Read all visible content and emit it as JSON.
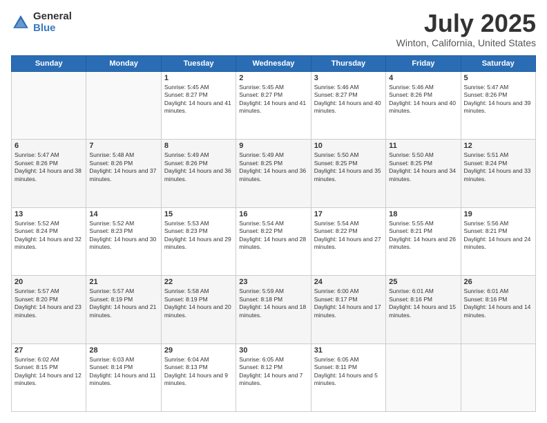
{
  "header": {
    "logo_general": "General",
    "logo_blue": "Blue",
    "month_title": "July 2025",
    "location": "Winton, California, United States"
  },
  "days_of_week": [
    "Sunday",
    "Monday",
    "Tuesday",
    "Wednesday",
    "Thursday",
    "Friday",
    "Saturday"
  ],
  "weeks": [
    [
      {
        "day": "",
        "sunrise": "",
        "sunset": "",
        "daylight": ""
      },
      {
        "day": "",
        "sunrise": "",
        "sunset": "",
        "daylight": ""
      },
      {
        "day": "1",
        "sunrise": "Sunrise: 5:45 AM",
        "sunset": "Sunset: 8:27 PM",
        "daylight": "Daylight: 14 hours and 41 minutes."
      },
      {
        "day": "2",
        "sunrise": "Sunrise: 5:45 AM",
        "sunset": "Sunset: 8:27 PM",
        "daylight": "Daylight: 14 hours and 41 minutes."
      },
      {
        "day": "3",
        "sunrise": "Sunrise: 5:46 AM",
        "sunset": "Sunset: 8:27 PM",
        "daylight": "Daylight: 14 hours and 40 minutes."
      },
      {
        "day": "4",
        "sunrise": "Sunrise: 5:46 AM",
        "sunset": "Sunset: 8:26 PM",
        "daylight": "Daylight: 14 hours and 40 minutes."
      },
      {
        "day": "5",
        "sunrise": "Sunrise: 5:47 AM",
        "sunset": "Sunset: 8:26 PM",
        "daylight": "Daylight: 14 hours and 39 minutes."
      }
    ],
    [
      {
        "day": "6",
        "sunrise": "Sunrise: 5:47 AM",
        "sunset": "Sunset: 8:26 PM",
        "daylight": "Daylight: 14 hours and 38 minutes."
      },
      {
        "day": "7",
        "sunrise": "Sunrise: 5:48 AM",
        "sunset": "Sunset: 8:26 PM",
        "daylight": "Daylight: 14 hours and 37 minutes."
      },
      {
        "day": "8",
        "sunrise": "Sunrise: 5:49 AM",
        "sunset": "Sunset: 8:26 PM",
        "daylight": "Daylight: 14 hours and 36 minutes."
      },
      {
        "day": "9",
        "sunrise": "Sunrise: 5:49 AM",
        "sunset": "Sunset: 8:25 PM",
        "daylight": "Daylight: 14 hours and 36 minutes."
      },
      {
        "day": "10",
        "sunrise": "Sunrise: 5:50 AM",
        "sunset": "Sunset: 8:25 PM",
        "daylight": "Daylight: 14 hours and 35 minutes."
      },
      {
        "day": "11",
        "sunrise": "Sunrise: 5:50 AM",
        "sunset": "Sunset: 8:25 PM",
        "daylight": "Daylight: 14 hours and 34 minutes."
      },
      {
        "day": "12",
        "sunrise": "Sunrise: 5:51 AM",
        "sunset": "Sunset: 8:24 PM",
        "daylight": "Daylight: 14 hours and 33 minutes."
      }
    ],
    [
      {
        "day": "13",
        "sunrise": "Sunrise: 5:52 AM",
        "sunset": "Sunset: 8:24 PM",
        "daylight": "Daylight: 14 hours and 32 minutes."
      },
      {
        "day": "14",
        "sunrise": "Sunrise: 5:52 AM",
        "sunset": "Sunset: 8:23 PM",
        "daylight": "Daylight: 14 hours and 30 minutes."
      },
      {
        "day": "15",
        "sunrise": "Sunrise: 5:53 AM",
        "sunset": "Sunset: 8:23 PM",
        "daylight": "Daylight: 14 hours and 29 minutes."
      },
      {
        "day": "16",
        "sunrise": "Sunrise: 5:54 AM",
        "sunset": "Sunset: 8:22 PM",
        "daylight": "Daylight: 14 hours and 28 minutes."
      },
      {
        "day": "17",
        "sunrise": "Sunrise: 5:54 AM",
        "sunset": "Sunset: 8:22 PM",
        "daylight": "Daylight: 14 hours and 27 minutes."
      },
      {
        "day": "18",
        "sunrise": "Sunrise: 5:55 AM",
        "sunset": "Sunset: 8:21 PM",
        "daylight": "Daylight: 14 hours and 26 minutes."
      },
      {
        "day": "19",
        "sunrise": "Sunrise: 5:56 AM",
        "sunset": "Sunset: 8:21 PM",
        "daylight": "Daylight: 14 hours and 24 minutes."
      }
    ],
    [
      {
        "day": "20",
        "sunrise": "Sunrise: 5:57 AM",
        "sunset": "Sunset: 8:20 PM",
        "daylight": "Daylight: 14 hours and 23 minutes."
      },
      {
        "day": "21",
        "sunrise": "Sunrise: 5:57 AM",
        "sunset": "Sunset: 8:19 PM",
        "daylight": "Daylight: 14 hours and 21 minutes."
      },
      {
        "day": "22",
        "sunrise": "Sunrise: 5:58 AM",
        "sunset": "Sunset: 8:19 PM",
        "daylight": "Daylight: 14 hours and 20 minutes."
      },
      {
        "day": "23",
        "sunrise": "Sunrise: 5:59 AM",
        "sunset": "Sunset: 8:18 PM",
        "daylight": "Daylight: 14 hours and 18 minutes."
      },
      {
        "day": "24",
        "sunrise": "Sunrise: 6:00 AM",
        "sunset": "Sunset: 8:17 PM",
        "daylight": "Daylight: 14 hours and 17 minutes."
      },
      {
        "day": "25",
        "sunrise": "Sunrise: 6:01 AM",
        "sunset": "Sunset: 8:16 PM",
        "daylight": "Daylight: 14 hours and 15 minutes."
      },
      {
        "day": "26",
        "sunrise": "Sunrise: 6:01 AM",
        "sunset": "Sunset: 8:16 PM",
        "daylight": "Daylight: 14 hours and 14 minutes."
      }
    ],
    [
      {
        "day": "27",
        "sunrise": "Sunrise: 6:02 AM",
        "sunset": "Sunset: 8:15 PM",
        "daylight": "Daylight: 14 hours and 12 minutes."
      },
      {
        "day": "28",
        "sunrise": "Sunrise: 6:03 AM",
        "sunset": "Sunset: 8:14 PM",
        "daylight": "Daylight: 14 hours and 11 minutes."
      },
      {
        "day": "29",
        "sunrise": "Sunrise: 6:04 AM",
        "sunset": "Sunset: 8:13 PM",
        "daylight": "Daylight: 14 hours and 9 minutes."
      },
      {
        "day": "30",
        "sunrise": "Sunrise: 6:05 AM",
        "sunset": "Sunset: 8:12 PM",
        "daylight": "Daylight: 14 hours and 7 minutes."
      },
      {
        "day": "31",
        "sunrise": "Sunrise: 6:05 AM",
        "sunset": "Sunset: 8:11 PM",
        "daylight": "Daylight: 14 hours and 5 minutes."
      },
      {
        "day": "",
        "sunrise": "",
        "sunset": "",
        "daylight": ""
      },
      {
        "day": "",
        "sunrise": "",
        "sunset": "",
        "daylight": ""
      }
    ]
  ]
}
